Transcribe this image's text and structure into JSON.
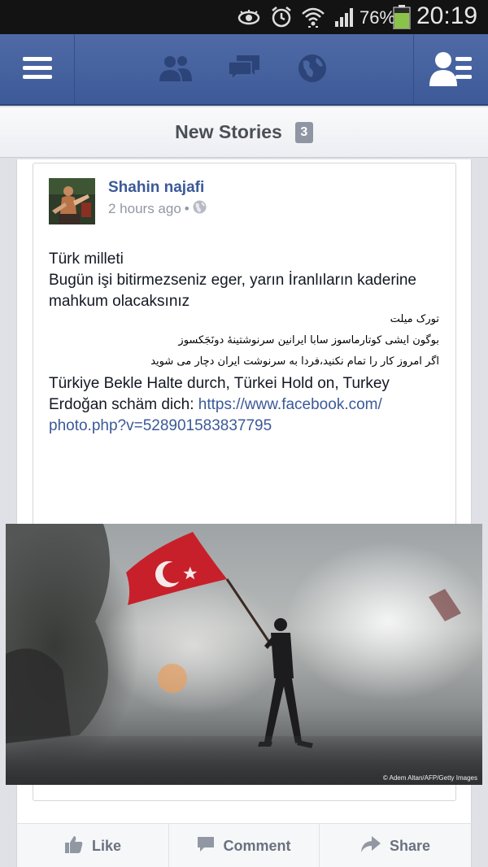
{
  "status_bar": {
    "battery_percent": "76%",
    "time": "20:19",
    "icons": [
      "eye-icon",
      "alarm-icon",
      "wifi-icon",
      "signal-icon",
      "battery-icon"
    ]
  },
  "nav": {
    "icons": [
      "menu-icon",
      "friends-icon",
      "messages-icon",
      "globe-icon",
      "contacts-icon"
    ],
    "brand_color": "#3b5998"
  },
  "stories": {
    "label": "New Stories",
    "count": "3"
  },
  "post": {
    "author": "Shahin najafi",
    "time": "2 hours ago",
    "separator": "•",
    "audience_icon": "globe-icon",
    "lines": [
      "Türk milleti",
      "Bugün işi bitirmezseniz eger, yarın İranlıların kaderine mahkum olacaksınız"
    ],
    "rtl_lines": [
      "تورک میلت",
      "بوگون ایشی کوتارماسوز سابا ایرانین سرنوشتینهٔ دونَجَکسوز",
      "اگر امروز کار را تمام نکنید،فردا به سرنوشت ایران دچار می شوید"
    ],
    "lines2": [
      "Türkiye Bekle",
      "Halte durch, Türkei",
      "Hold on, Turkey",
      "Erdoğan schäm dich:"
    ],
    "link_part1": "https://www.facebook.com/",
    "link_part2": "photo.php?v=528901583837795",
    "photo_credit": "© Adem Altan/AFP/Getty Images"
  },
  "actions": {
    "like": "Like",
    "comment": "Comment",
    "share": "Share"
  }
}
